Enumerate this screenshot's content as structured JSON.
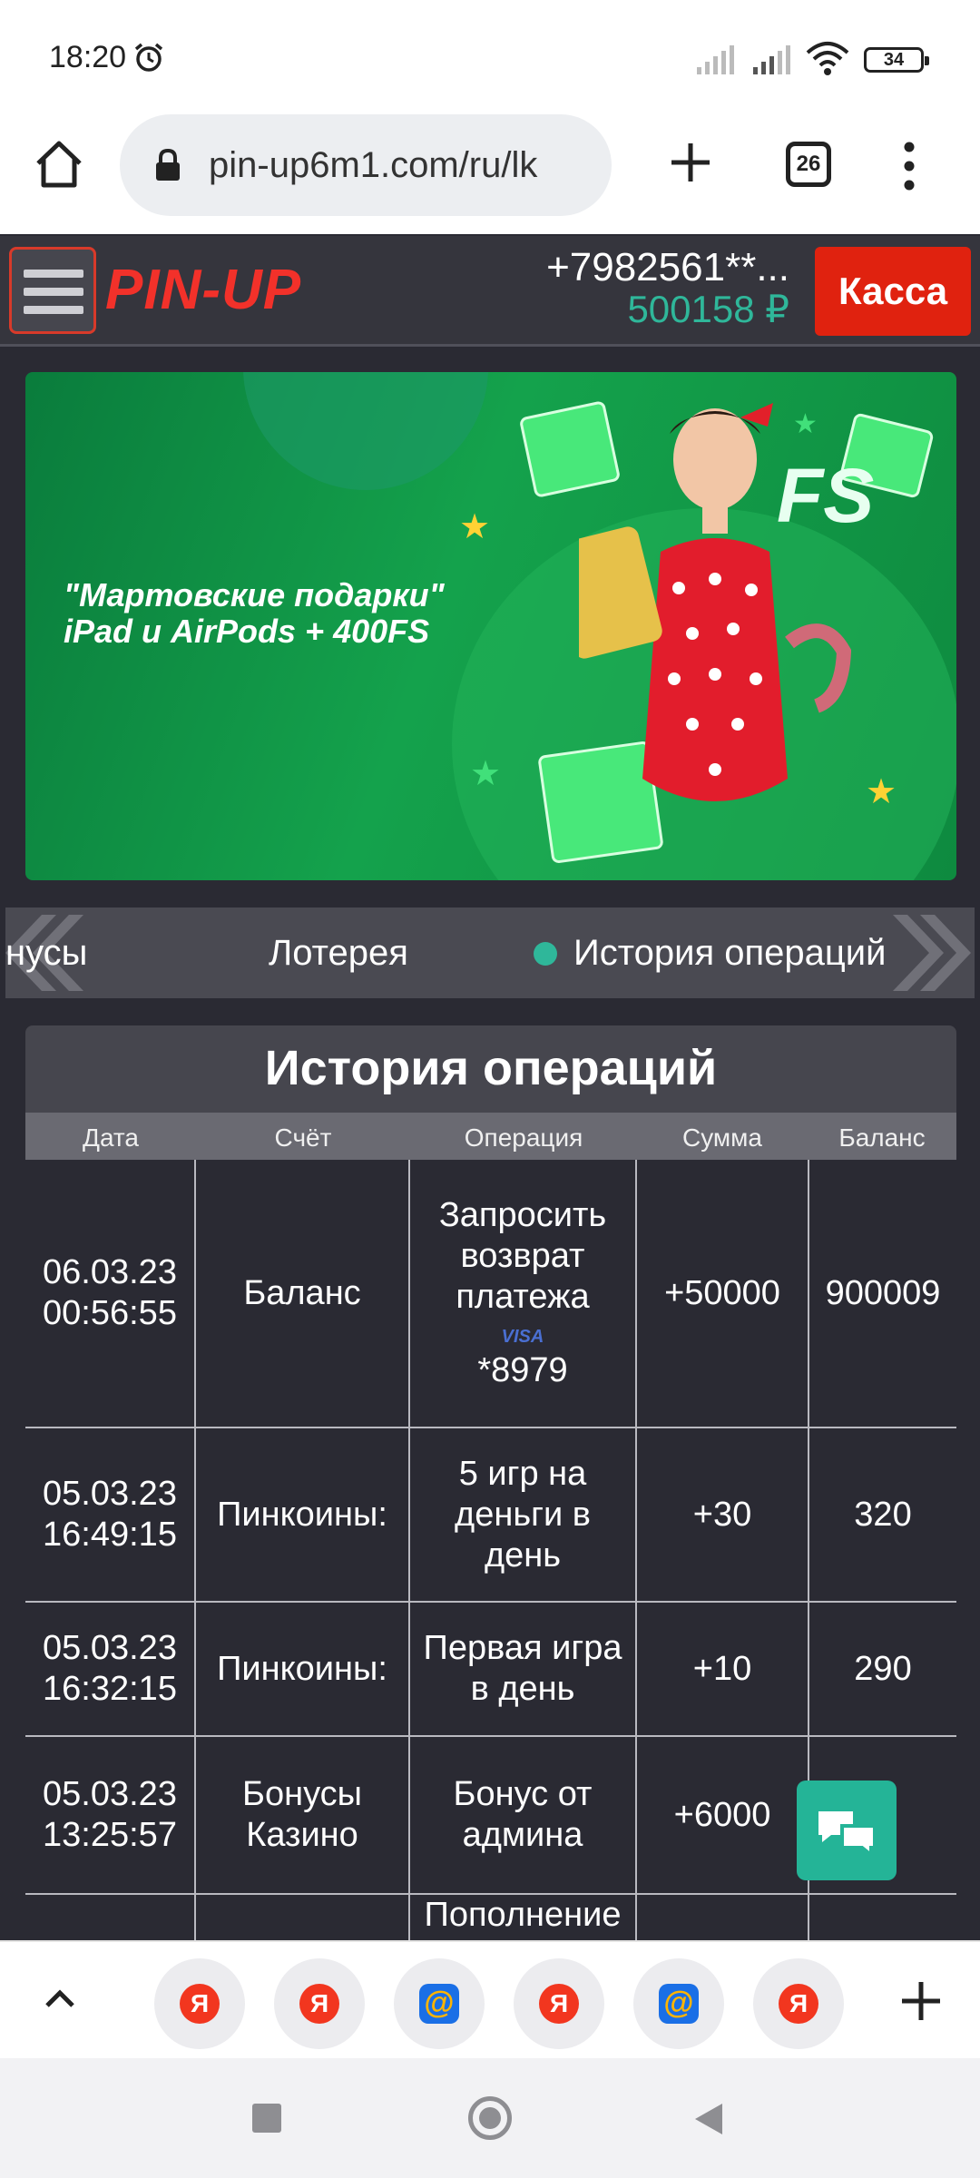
{
  "status_bar": {
    "time": "18:20",
    "battery": "34",
    "icons": [
      "alarm-icon",
      "signal-icon",
      "signal-icon",
      "wifi-icon",
      "battery-icon"
    ]
  },
  "browser": {
    "url": "pin-up6m1.com/ru/lk",
    "tab_count": "26",
    "icons": [
      "home-icon",
      "lock-icon",
      "plus-icon",
      "tabs-icon",
      "more-vert-icon"
    ]
  },
  "site_header": {
    "logo": "PIN-UP",
    "phone": "+7982561**...",
    "balance": "500158 ₽",
    "cashier_label": "Касса"
  },
  "banner": {
    "line1": "\"Мартовские подарки\"",
    "line2": "iPad и AirPods + 400FS",
    "fs_badge": "FS"
  },
  "tabs": {
    "items": [
      "нусы",
      "Лотерея",
      "История операций"
    ],
    "active_index": 2
  },
  "history": {
    "title": "История операций",
    "columns": [
      "Дата",
      "Счёт",
      "Операция",
      "Сумма",
      "Баланс"
    ],
    "rows": [
      {
        "date": "06.03.23",
        "time": "00:56:55",
        "account": "Баланс",
        "operation": "Запросить возврат платежа",
        "card_brand": "VISA",
        "card": "*8979",
        "amount": "+50000",
        "balance": "900009"
      },
      {
        "date": "05.03.23",
        "time": "16:49:15",
        "account": "Пинкоины:",
        "operation": "5 игр на деньги в день",
        "amount": "+30",
        "balance": "320"
      },
      {
        "date": "05.03.23",
        "time": "16:32:15",
        "account": "Пинкоины:",
        "operation": "Первая игра в день",
        "amount": "+10",
        "balance": "290"
      },
      {
        "date": "05.03.23",
        "time": "13:25:57",
        "account": "Бонусы Казино",
        "operation": "Бонус от админа",
        "amount": "+6000",
        "balance": ""
      },
      {
        "operation_partial": "Пополнение"
      }
    ]
  },
  "bottom_toolbar": {
    "quick_links": [
      "Я",
      "Я",
      "@",
      "Я",
      "@",
      "Я"
    ]
  },
  "colors": {
    "brand_red": "#f2312a",
    "accent_teal": "#2fb79a",
    "page_bg": "#2a2a33"
  }
}
